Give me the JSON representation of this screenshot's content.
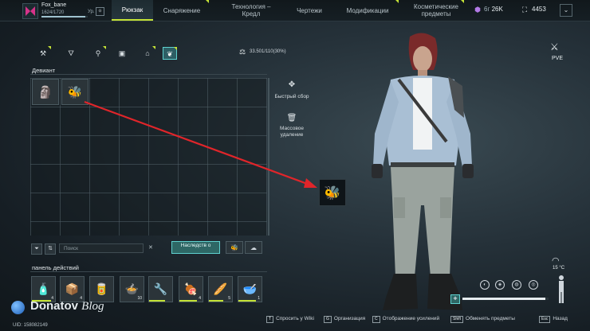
{
  "player": {
    "name": "Fox_bane",
    "xp": "1624/1720",
    "xp_ratio": 0.94,
    "level_label": "Ур."
  },
  "tabs": [
    {
      "label": "Рюкзак",
      "active": true
    },
    {
      "label": "Снаряжение",
      "active": false
    },
    {
      "label": "Технология – Кредл",
      "active": false
    },
    {
      "label": "Чертежи",
      "active": false
    },
    {
      "label": "Модификации",
      "active": false
    },
    {
      "label": "Косметические предметы",
      "active": false
    }
  ],
  "currency": {
    "premium": "26K",
    "premium_prefix": "6г",
    "coins": "4453"
  },
  "categories": [
    "tool-icon",
    "bottle-icon",
    "syringe-icon",
    "box-icon",
    "house-icon",
    "deviant-icon"
  ],
  "weight": "33.501/110(30%)",
  "sections": {
    "deviant": "Девиант",
    "actions_panel": "панель действий"
  },
  "side_actions": {
    "quick_collect": "Быстрый сбор",
    "bulk_delete": "Массовое удаление"
  },
  "search": {
    "placeholder": "Поиск"
  },
  "inherit_button": "Наследств о",
  "action_bar": [
    {
      "icon": "bottle-icon",
      "count": "4"
    },
    {
      "icon": "crate-icon",
      "count": "4"
    },
    {
      "icon": "canister-icon",
      "count": ""
    },
    {
      "icon": "pot-icon",
      "count": "10"
    },
    {
      "icon": "wrench-icon",
      "count": ""
    },
    {
      "icon": "meat-icon",
      "count": "4"
    },
    {
      "icon": "bread-icon",
      "count": "5"
    },
    {
      "icon": "mortar-icon",
      "count": "1"
    }
  ],
  "hud": {
    "mode": "PVE",
    "temperature": "15 °C"
  },
  "hints": [
    {
      "key": "T",
      "label": "Спросить у Wiki"
    },
    {
      "key": "G",
      "label": "Организация"
    },
    {
      "key": "C",
      "label": "Отображение усилений"
    },
    {
      "key": "Shift",
      "label": "Обменять предметы"
    },
    {
      "key": "Esc",
      "label": "Назад"
    }
  ],
  "uid": "UID: 158082149",
  "watermark": {
    "brand": "Donatov",
    "suffix": "Blog"
  },
  "colors": {
    "accent": "#c4e236",
    "teal": "#5fd1cf",
    "arrow": "#e0252a"
  }
}
